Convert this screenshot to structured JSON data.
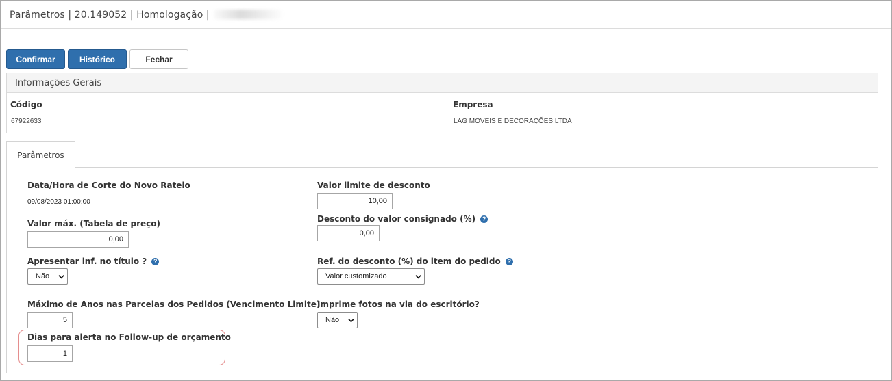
{
  "header": {
    "title": "Parâmetros | 20.149052 | Homologação |"
  },
  "toolbar": {
    "confirm_label": "Confirmar",
    "history_label": "Histórico",
    "close_label": "Fechar"
  },
  "general_info": {
    "heading": "Informações Gerais",
    "code_label": "Código",
    "code_value": "67922633",
    "company_label": "Empresa",
    "company_value": "LAG MOVEIS E DECORAÇÕES LTDA"
  },
  "tabs": [
    {
      "label": "Parâmetros",
      "active": true
    }
  ],
  "params": {
    "cutoff_label": "Data/Hora de Corte do Novo Rateio",
    "cutoff_value": "09/08/2023 01:00:00",
    "max_price_label": "Valor máx. (Tabela de preço)",
    "max_price_value": "0,00",
    "show_info_label": "Apresentar inf. no título ?",
    "show_info_value": "Não",
    "max_years_label": "Máximo de Anos nas Parcelas dos Pedidos (Vencimento Limite)",
    "max_years_value": "5",
    "followup_label": "Dias para alerta no Follow-up de orçamento",
    "followup_value": "1",
    "discount_limit_label": "Valor limite de desconto",
    "discount_limit_value": "10,00",
    "consigned_discount_label": "Desconto do valor consignado (%)",
    "consigned_discount_value": "0,00",
    "discount_ref_label": "Ref. do desconto (%) do item do pedido",
    "discount_ref_value": "Valor customizado",
    "print_photos_label": "Imprime fotos na via do escritório?",
    "print_photos_value": "Não"
  },
  "icons": {
    "help": "question-circle-icon",
    "select_caret": "chevron-down-icon"
  },
  "colors": {
    "primary": "#2f6fad",
    "highlight": "#e58e8e"
  }
}
